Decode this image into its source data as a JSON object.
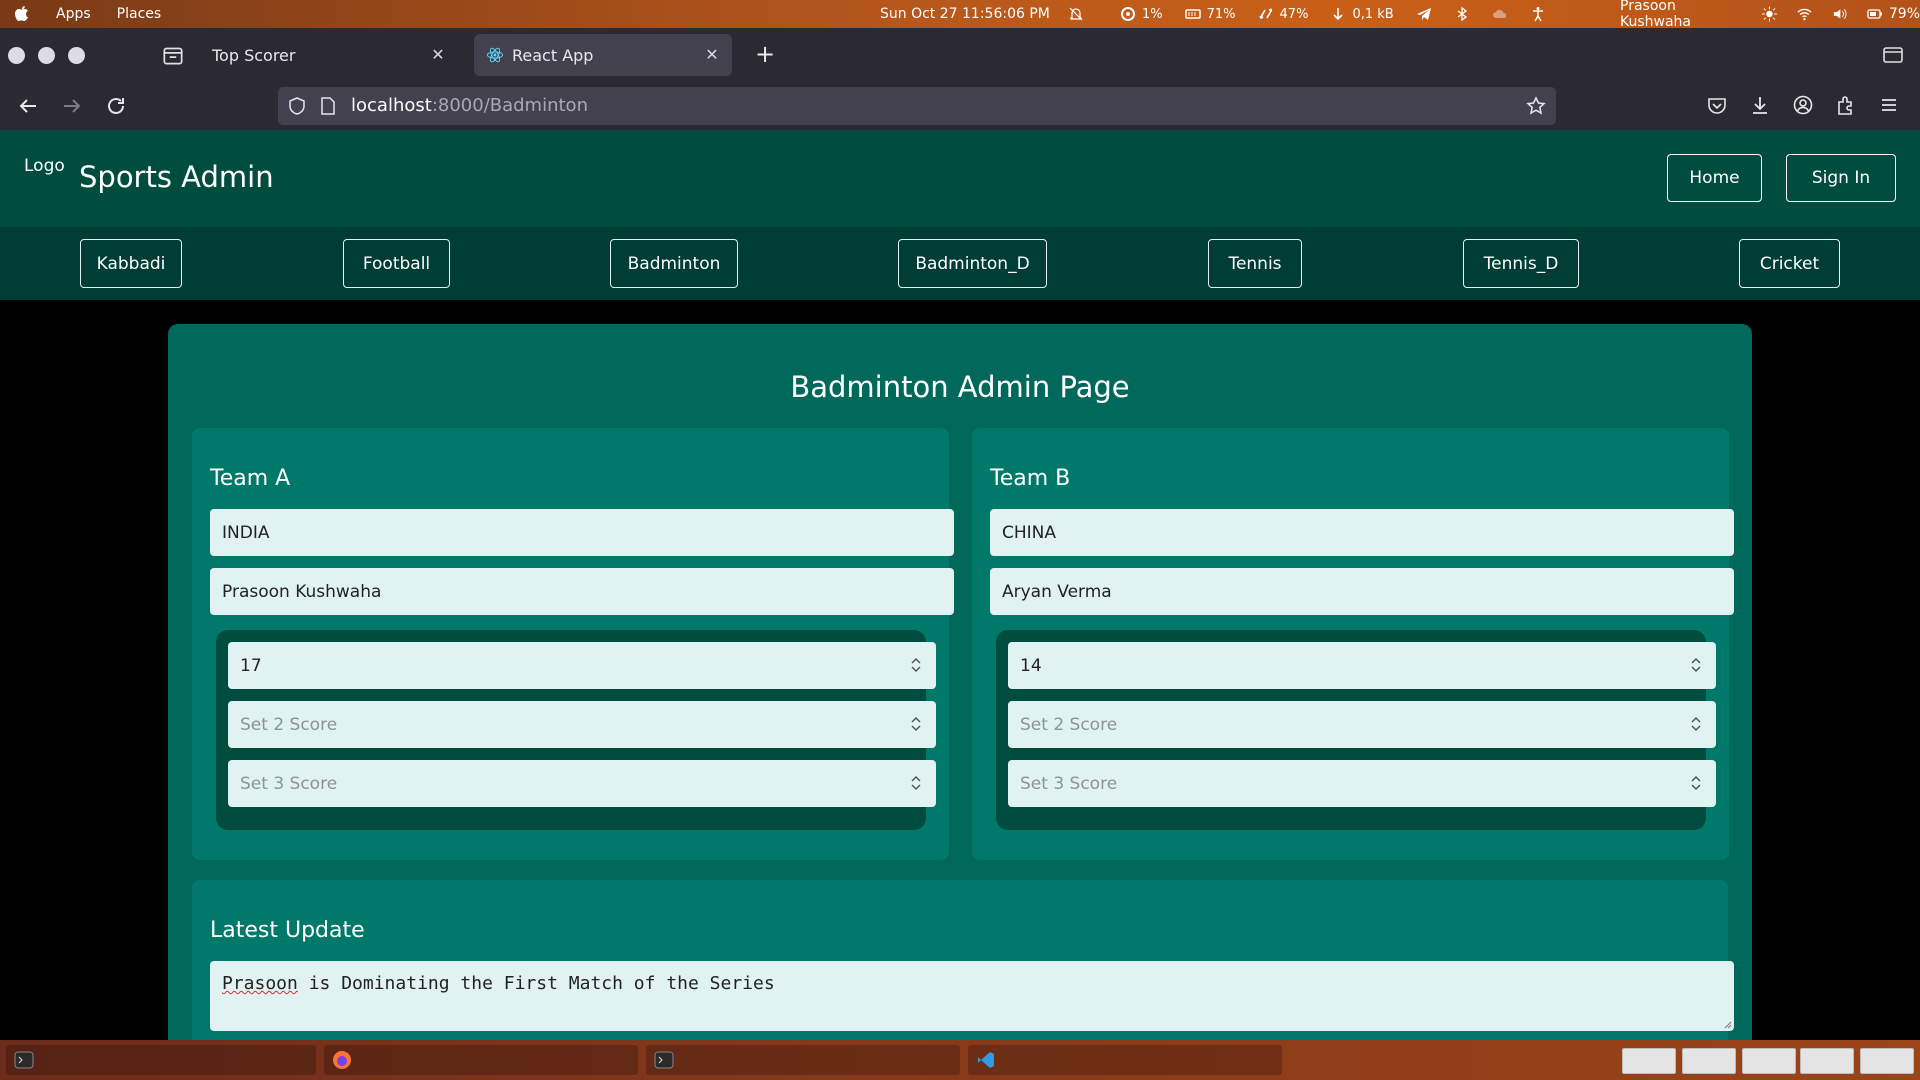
{
  "os": {
    "menu": [
      "Apps",
      "Places"
    ],
    "datetime": "Sun Oct 27  11:56:06 PM",
    "indicators": [
      {
        "icon": "cpu-icon",
        "value": "1%"
      },
      {
        "icon": "memory-icon",
        "value": "71%"
      },
      {
        "icon": "swap-icon",
        "value": "47%"
      },
      {
        "icon": "download-arrow-icon",
        "value": "0,1 kB"
      }
    ],
    "user": "Prasoon Kushwaha",
    "battery": "79%"
  },
  "browser": {
    "tabs": [
      {
        "title": "Top Scorer",
        "active": false
      },
      {
        "title": "React App",
        "active": true
      }
    ],
    "url_host": "localhost",
    "url_port": ":8000",
    "url_path": "/Badminton"
  },
  "app": {
    "logo": "Logo",
    "brand": "Sports Admin",
    "header_buttons": {
      "home": "Home",
      "signin": "Sign In"
    },
    "sports": [
      "Kabbadi",
      "Football",
      "Badminton",
      "Badminton_D",
      "Tennis",
      "Tennis_D",
      "Cricket"
    ],
    "page_title": "Badminton Admin Page",
    "team_a": {
      "title": "Team A",
      "country": "INDIA",
      "player": "Prasoon Kushwaha",
      "set1": "17",
      "set2_placeholder": "Set 2 Score",
      "set3_placeholder": "Set 3 Score"
    },
    "team_b": {
      "title": "Team B",
      "country": "CHINA",
      "player": "Aryan Verma",
      "set1": "14",
      "set2_placeholder": "Set 2 Score",
      "set3_placeholder": "Set 3 Score"
    },
    "update": {
      "title": "Latest Update",
      "first_word": "Prasoon",
      "rest": " is Dominating the First Match of the Series"
    }
  },
  "colors": {
    "header": "#004d40",
    "nav": "#003d35",
    "card": "#00695c",
    "team_card": "#00796b",
    "input_bg": "#e0f2f1"
  }
}
